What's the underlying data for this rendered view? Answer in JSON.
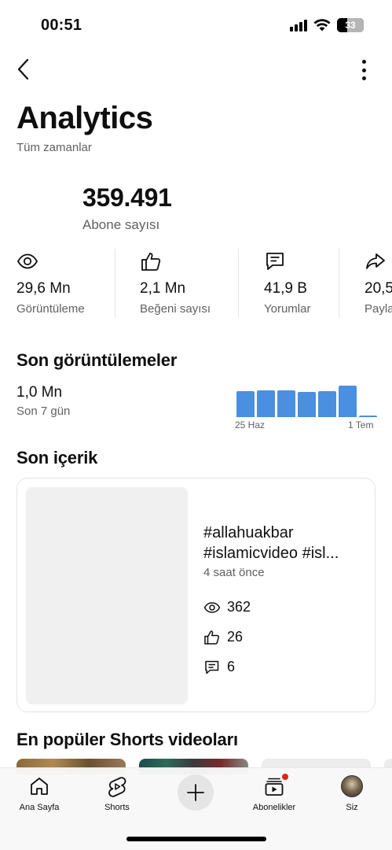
{
  "status_bar": {
    "time": "00:51",
    "battery": "33"
  },
  "header": {
    "title": "Analytics",
    "subtitle": "Tüm zamanlar"
  },
  "subscribers": {
    "count": "359.491",
    "label": "Abone sayısı"
  },
  "stats": [
    {
      "icon": "eye-icon",
      "value": "29,6 Mn",
      "label": "Görüntüleme"
    },
    {
      "icon": "thumbs-up-icon",
      "value": "2,1 Mn",
      "label": "Beğeni sayısı"
    },
    {
      "icon": "comment-icon",
      "value": "41,9 B",
      "label": "Yorumlar"
    },
    {
      "icon": "share-icon",
      "value": "20,5",
      "label": "Payla"
    }
  ],
  "recent_views": {
    "title": "Son görüntülemeler",
    "value": "1,0 Mn",
    "period": "Son 7 gün",
    "axis_start": "25 Haz",
    "axis_end": "1 Tem",
    "bars": [
      0.78,
      0.8,
      0.8,
      0.76,
      0.78,
      0.95,
      0.05
    ],
    "color": "#4a8fe0"
  },
  "latest_content": {
    "title": "Son içerik",
    "video_title": "#allahuakbar #islamicvideo #isl...",
    "time": "4 saat önce",
    "views": "362",
    "likes": "26",
    "comments": "6"
  },
  "popular_shorts": {
    "title": "En popüler Shorts videoları"
  },
  "bottom_nav": [
    {
      "label": "Ana Sayfa",
      "icon": "home-icon"
    },
    {
      "label": "Shorts",
      "icon": "shorts-icon"
    },
    {
      "label": "",
      "icon": "plus-icon"
    },
    {
      "label": "Abonelikler",
      "icon": "subscriptions-icon"
    },
    {
      "label": "Siz",
      "icon": "avatar"
    }
  ]
}
